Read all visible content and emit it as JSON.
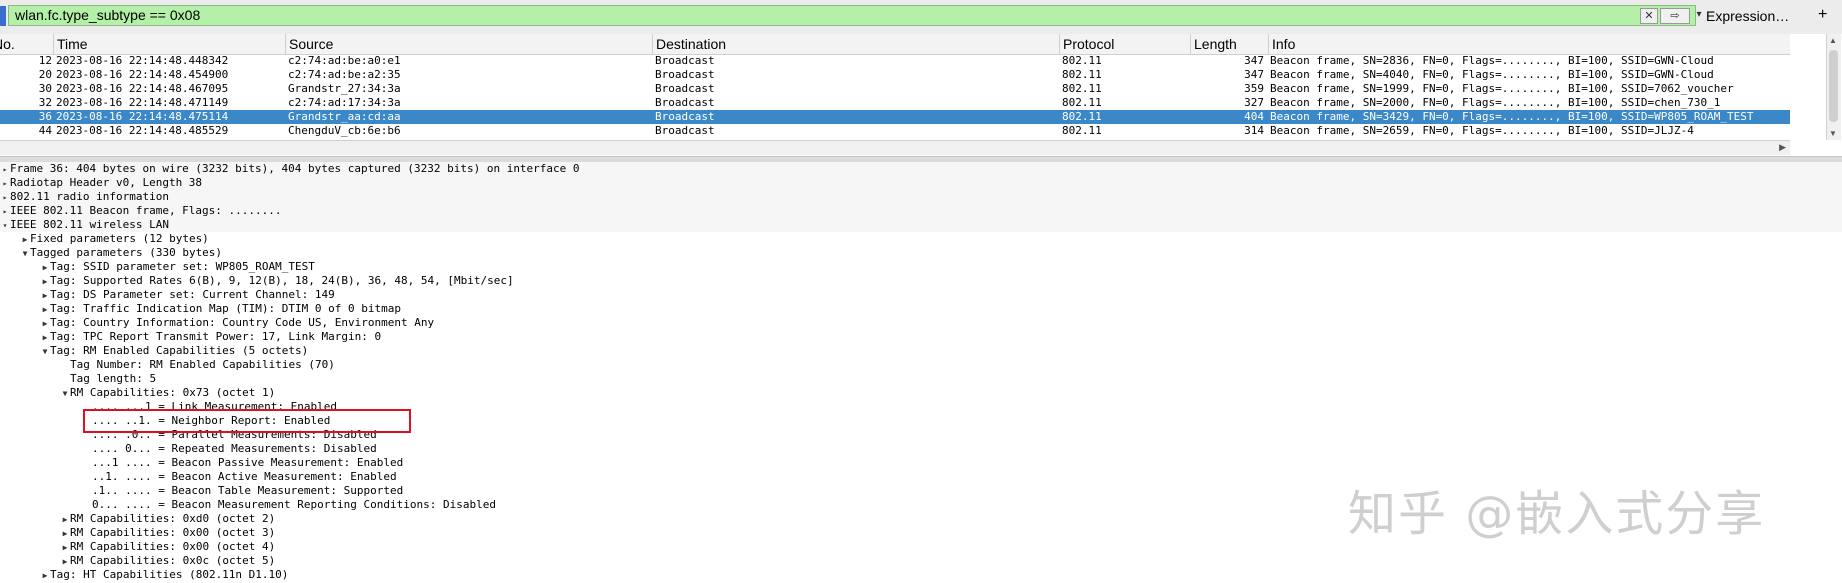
{
  "filter": {
    "value": "wlan.fc.type_subtype == 0x08",
    "expression_label": "Expression…",
    "plus_label": "+"
  },
  "packet_list": {
    "columns": [
      "No.",
      "Time",
      "Source",
      "Destination",
      "Protocol",
      "Length",
      "Info"
    ],
    "rows": [
      {
        "no": "12",
        "time": "2023-08-16 22:14:48.448342",
        "source": "c2:74:ad:be:a0:e1",
        "destination": "Broadcast",
        "protocol": "802.11",
        "length": "347",
        "info": "Beacon frame, SN=2836, FN=0, Flags=........, BI=100, SSID=GWN-Cloud"
      },
      {
        "no": "20",
        "time": "2023-08-16 22:14:48.454900",
        "source": "c2:74:ad:be:a2:35",
        "destination": "Broadcast",
        "protocol": "802.11",
        "length": "347",
        "info": "Beacon frame, SN=4040, FN=0, Flags=........, BI=100, SSID=GWN-Cloud"
      },
      {
        "no": "30",
        "time": "2023-08-16 22:14:48.467095",
        "source": "Grandstr_27:34:3a",
        "destination": "Broadcast",
        "protocol": "802.11",
        "length": "359",
        "info": "Beacon frame, SN=1999, FN=0, Flags=........, BI=100, SSID=7062_voucher"
      },
      {
        "no": "32",
        "time": "2023-08-16 22:14:48.471149",
        "source": "c2:74:ad:17:34:3a",
        "destination": "Broadcast",
        "protocol": "802.11",
        "length": "327",
        "info": "Beacon frame, SN=2000, FN=0, Flags=........, BI=100, SSID=chen_730_1"
      },
      {
        "no": "36",
        "time": "2023-08-16 22:14:48.475114",
        "source": "Grandstr_aa:cd:aa",
        "destination": "Broadcast",
        "protocol": "802.11",
        "length": "404",
        "info": "Beacon frame, SN=3429, FN=0, Flags=........, BI=100, SSID=WP805_ROAM_TEST"
      },
      {
        "no": "44",
        "time": "2023-08-16 22:14:48.485529",
        "source": "ChengduV_cb:6e:b6",
        "destination": "Broadcast",
        "protocol": "802.11",
        "length": "314",
        "info": "Beacon frame, SN=2659, FN=0, Flags=........, BI=100, SSID=JLJZ-4"
      }
    ]
  },
  "detail_tree": [
    {
      "depth": 0,
      "expander": "▸",
      "text": "Frame 36: 404 bytes on wire (3232 bits), 404 bytes captured (3232 bits) on interface 0"
    },
    {
      "depth": 0,
      "expander": "▸",
      "text": "Radiotap Header v0, Length 38"
    },
    {
      "depth": 0,
      "expander": "▸",
      "text": "802.11 radio information"
    },
    {
      "depth": 0,
      "expander": "▸",
      "text": "IEEE 802.11 Beacon frame, Flags: ........"
    },
    {
      "depth": 0,
      "expander": "▾",
      "text": "IEEE 802.11 wireless LAN"
    },
    {
      "depth": 1,
      "expander": "▶",
      "text": "Fixed parameters (12 bytes)"
    },
    {
      "depth": 1,
      "expander": "▼",
      "text": "Tagged parameters (330 bytes)"
    },
    {
      "depth": 2,
      "expander": "▶",
      "text": "Tag: SSID parameter set: WP805_ROAM_TEST"
    },
    {
      "depth": 2,
      "expander": "▶",
      "text": "Tag: Supported Rates 6(B), 9, 12(B), 18, 24(B), 36, 48, 54, [Mbit/sec]"
    },
    {
      "depth": 2,
      "expander": "▶",
      "text": "Tag: DS Parameter set: Current Channel: 149"
    },
    {
      "depth": 2,
      "expander": "▶",
      "text": "Tag: Traffic Indication Map (TIM): DTIM 0 of 0 bitmap"
    },
    {
      "depth": 2,
      "expander": "▶",
      "text": "Tag: Country Information: Country Code US, Environment Any"
    },
    {
      "depth": 2,
      "expander": "▶",
      "text": "Tag: TPC Report Transmit Power: 17, Link Margin: 0"
    },
    {
      "depth": 2,
      "expander": "▼",
      "text": "Tag: RM Enabled Capabilities (5 octets)"
    },
    {
      "depth": 3,
      "expander": "",
      "text": "Tag Number: RM Enabled Capabilities (70)"
    },
    {
      "depth": 3,
      "expander": "",
      "text": "Tag length: 5"
    },
    {
      "depth": 3,
      "expander": "▼",
      "text": "RM Capabilities: 0x73 (octet 1)"
    },
    {
      "depth": 4,
      "expander": "",
      "text": ".... ...1 = Link Measurement: Enabled"
    },
    {
      "depth": 4,
      "expander": "",
      "text": ".... ..1. = Neighbor Report: Enabled"
    },
    {
      "depth": 4,
      "expander": "",
      "text": ".... .0.. = Parallel Measurements: Disabled"
    },
    {
      "depth": 4,
      "expander": "",
      "text": ".... 0... = Repeated Measurements: Disabled"
    },
    {
      "depth": 4,
      "expander": "",
      "text": "...1 .... = Beacon Passive Measurement: Enabled"
    },
    {
      "depth": 4,
      "expander": "",
      "text": "..1. .... = Beacon Active Measurement: Enabled"
    },
    {
      "depth": 4,
      "expander": "",
      "text": ".1.. .... = Beacon Table Measurement: Supported"
    },
    {
      "depth": 4,
      "expander": "",
      "text": "0... .... = Beacon Measurement Reporting Conditions: Disabled"
    },
    {
      "depth": 3,
      "expander": "▶",
      "text": "RM Capabilities: 0xd0 (octet 2)"
    },
    {
      "depth": 3,
      "expander": "▶",
      "text": "RM Capabilities: 0x00 (octet 3)"
    },
    {
      "depth": 3,
      "expander": "▶",
      "text": "RM Capabilities: 0x00 (octet 4)"
    },
    {
      "depth": 3,
      "expander": "▶",
      "text": "RM Capabilities: 0x0c (octet 5)"
    },
    {
      "depth": 2,
      "expander": "▶",
      "text": "Tag: HT Capabilities (802.11n D1.10)"
    }
  ],
  "watermark": "知乎 @嵌入式分享",
  "colors": {
    "filter_valid": "#b4f0a8",
    "selected_row": "#3b88c8",
    "highlight_box": "#e01020"
  }
}
